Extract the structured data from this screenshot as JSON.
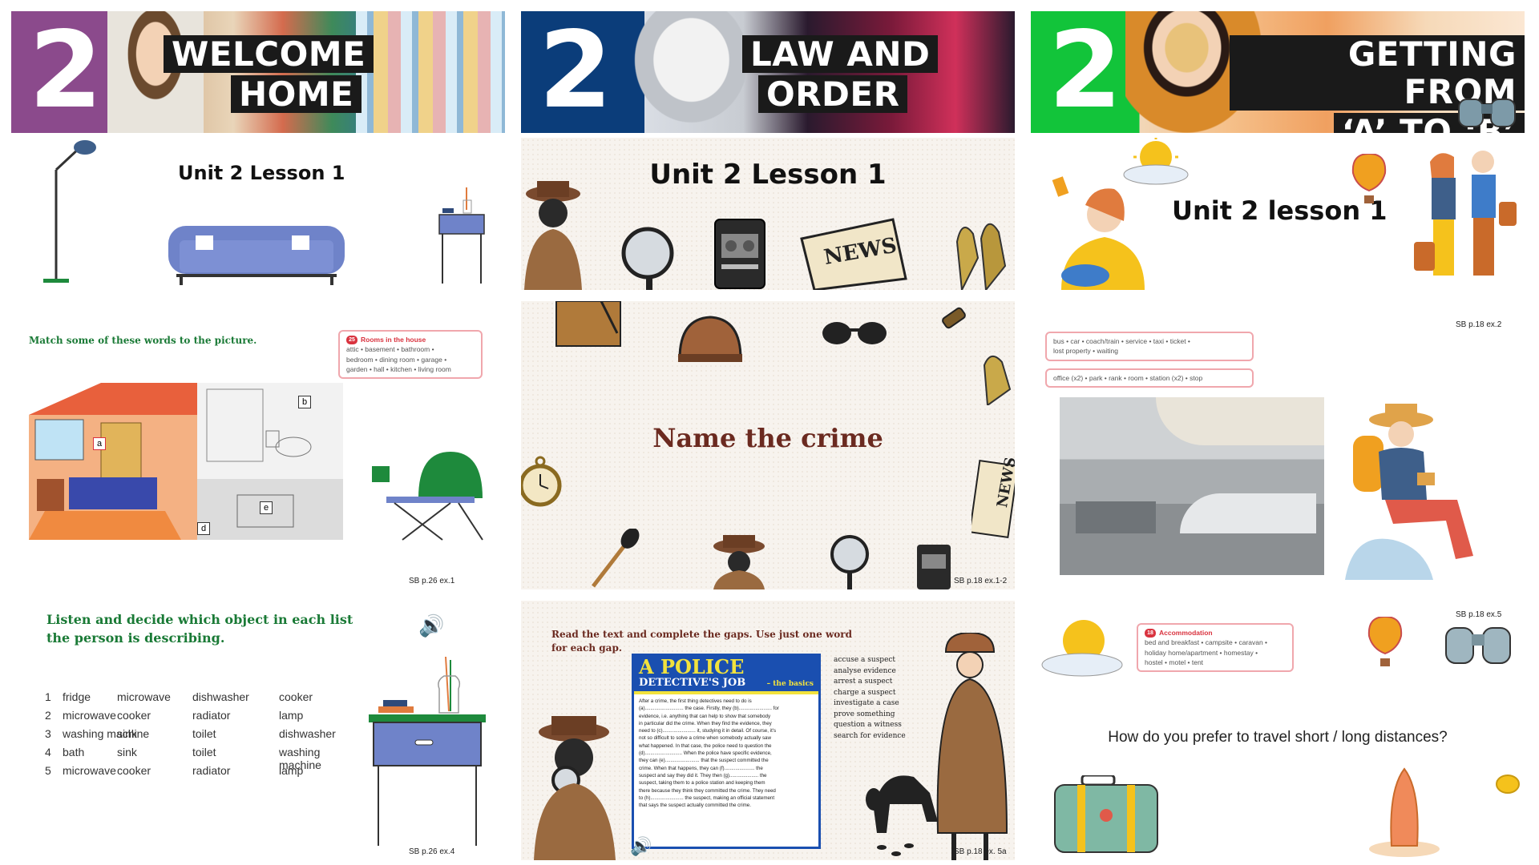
{
  "columns": [
    {
      "banner": {
        "number": "2",
        "title_line1": "WELCOME",
        "title_line2": "HOME",
        "accent": "#8b4a8c"
      },
      "slide1": {
        "title": "Unit 2 Lesson 1"
      },
      "slide2": {
        "instruction": "Match some of these words to the picture.",
        "wordbox": {
          "badge": "25",
          "heading": "Rooms in the house",
          "line1": "attic • basement • bathroom •",
          "line2": "bedroom • dining room • garage •",
          "line3": "garden • hall • kitchen • living room"
        },
        "labels": [
          "a",
          "b",
          "d",
          "e"
        ],
        "ref": "SB p.26 ex.1"
      },
      "slide3": {
        "instruction_line1": "Listen and decide which object in each list",
        "instruction_line2": "the person is describing.",
        "rows": [
          {
            "n": "1",
            "w": [
              "fridge",
              "microwave",
              "dishwasher",
              "cooker"
            ]
          },
          {
            "n": "2",
            "w": [
              "microwave",
              "cooker",
              "radiator",
              "lamp"
            ]
          },
          {
            "n": "3",
            "w": [
              "washing machine",
              "sink",
              "toilet",
              "dishwasher"
            ]
          },
          {
            "n": "4",
            "w": [
              "bath",
              "sink",
              "toilet",
              "washing machine"
            ]
          },
          {
            "n": "5",
            "w": [
              "microwave",
              "cooker",
              "radiator",
              "lamp"
            ]
          }
        ],
        "ref": "SB p.26 ex.4"
      }
    },
    {
      "banner": {
        "number": "2",
        "title_line1": "LAW AND",
        "title_line2": "ORDER",
        "accent": "#0b3d7a"
      },
      "slide1": {
        "title": "Unit 2 Lesson 1"
      },
      "slide2": {
        "title": "Name the crime",
        "ref": "SB p.18 ex.1-2"
      },
      "slide3": {
        "instruction_line1": "Read the text and complete the gaps. Use just one word",
        "instruction_line2": "for each gap.",
        "article_title1": "A POLICE",
        "article_title2": "DETECTIVE'S JOB",
        "article_sub": "– the basics",
        "article_lines": [
          "After a crime, the first thing detectives need to do is",
          "(a)............................ the case. Firstly, they (b)........................ for",
          "evidence, i.e. anything that can help to show that somebody",
          "in particular did the crime. When they find the evidence, they",
          "need to (c)........................ it, studying it in detail. Of course, it's",
          "not so difficult to solve a crime when somebody actually saw",
          "what happened. In that case, the police need to question the",
          "(d)........................... When the police have specific evidence,",
          "they can (e)......................... that the suspect committed the",
          "crime. When that happens, they can (f)...................... the",
          "suspect and say they did it. They then (g)..................... the",
          "suspect, taking them to a police station and keeping them",
          "there because they think they committed the crime. They need",
          "to (h)........................ the suspect, making an official statement",
          "that says the suspect actually committed the crime."
        ],
        "phrases": [
          "accuse a suspect",
          "analyse evidence",
          "arrest a suspect",
          "charge a suspect",
          "investigate a case",
          "prove something",
          "question a witness",
          "search for evidence"
        ],
        "ref": "SB p.18 ex. 5a"
      }
    },
    {
      "banner": {
        "number": "2",
        "title_line1": "GETTING FROM",
        "title_line2": "‘A’ TO ‘B’",
        "accent": "#12c43a"
      },
      "slide1": {
        "title": "Unit 2 lesson 1"
      },
      "slide2": {
        "box1_line1": "bus • car • coach/train • service • taxi • ticket •",
        "box1_line2": "lost property • waiting",
        "box2": "office (x2) • park • rank • room • station (x2) • stop",
        "ref": "SB p.18 ex.2"
      },
      "slide3": {
        "wordbox": {
          "badge": "18",
          "heading": "Accommodation",
          "line1": "bed and breakfast • campsite • caravan •",
          "line2": "holiday home/apartment • homestay •",
          "line3": "hostel • motel • tent"
        },
        "question": "How do you prefer to travel short / long distances?",
        "ref": "SB p.18 ex.5"
      }
    }
  ]
}
